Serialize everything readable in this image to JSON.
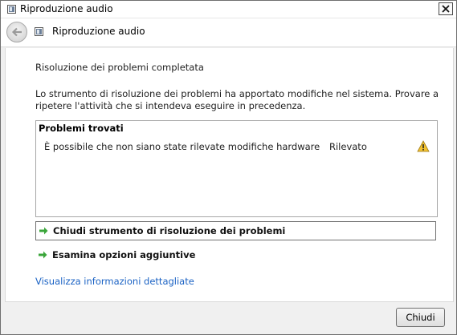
{
  "window": {
    "title": "Riproduzione audio",
    "close_icon": "close-icon"
  },
  "nav": {
    "back_icon": "back-arrow-icon",
    "title": "Riproduzione audio"
  },
  "content": {
    "heading": "Risoluzione dei problemi completata",
    "description": "Lo strumento di risoluzione dei problemi ha apportato modifiche nel sistema. Provare a ripetere l'attività che si intendeva eseguire in precedenza.",
    "problems": {
      "title": "Problemi trovati",
      "items": [
        {
          "text": "È possibile che non siano state rilevate modifiche hardware",
          "status": "Rilevato",
          "icon": "warning-icon"
        }
      ]
    },
    "actions": {
      "close_troubleshooter": "Chiudi strumento di risoluzione dei problemi",
      "explore_options": "Esamina opzioni aggiuntive"
    },
    "details_link": "Visualizza informazioni dettagliate"
  },
  "footer": {
    "close_label": "Chiudi"
  },
  "colors": {
    "link": "#1a62c4",
    "arrow_green": "#3aa53a",
    "warning_yellow": "#f2c230"
  }
}
